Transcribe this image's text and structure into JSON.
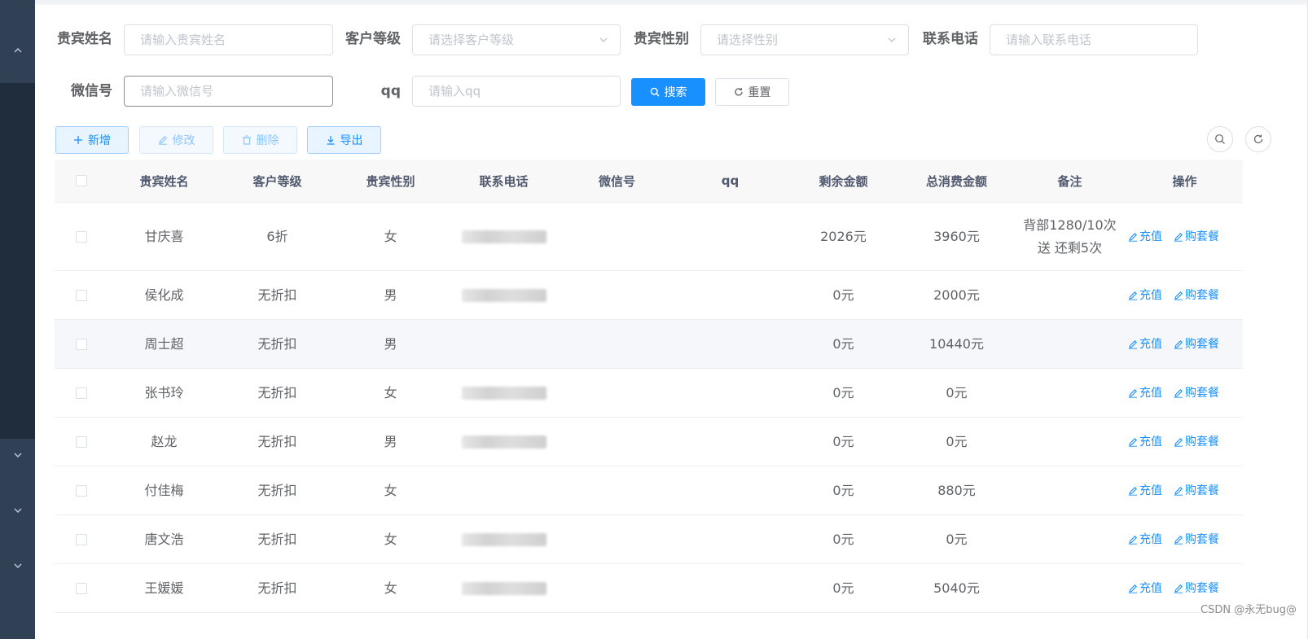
{
  "search_form": {
    "guest_name": {
      "label": "贵宾姓名",
      "placeholder": "请输入贵宾姓名"
    },
    "customer_level": {
      "label": "客户等级",
      "placeholder": "请选择客户等级"
    },
    "guest_gender": {
      "label": "贵宾性别",
      "placeholder": "请选择性别"
    },
    "contact_phone": {
      "label": "联系电话",
      "placeholder": "请输入联系电话"
    },
    "wechat": {
      "label": "微信号",
      "placeholder": "请输入微信号"
    },
    "qq": {
      "label": "qq",
      "placeholder": "请输入qq"
    },
    "search_button": "搜索",
    "reset_button": "重置"
  },
  "toolbar": {
    "add": "新增",
    "edit": "修改",
    "delete": "删除",
    "export": "导出"
  },
  "table": {
    "columns": [
      "贵宾姓名",
      "客户等级",
      "贵宾性别",
      "联系电话",
      "微信号",
      "qq",
      "剩余金额",
      "总消费金额",
      "备注",
      "操作"
    ],
    "rows": [
      {
        "name": "甘庆喜",
        "level": "6折",
        "gender": "女",
        "phone_redacted": true,
        "wechat": "",
        "qq": "",
        "balance": "2026元",
        "total": "3960元",
        "note_line1": "背部1280/10次",
        "note_line2": "送 还剩5次"
      },
      {
        "name": "侯化成",
        "level": "无折扣",
        "gender": "男",
        "phone_redacted": true,
        "wechat": "",
        "qq": "",
        "balance": "0元",
        "total": "2000元",
        "note_line1": "",
        "note_line2": ""
      },
      {
        "name": "周士超",
        "level": "无折扣",
        "gender": "男",
        "phone_redacted": false,
        "wechat": "",
        "qq": "",
        "balance": "0元",
        "total": "10440元",
        "note_line1": "",
        "note_line2": ""
      },
      {
        "name": "张书玲",
        "level": "无折扣",
        "gender": "女",
        "phone_redacted": true,
        "wechat": "",
        "qq": "",
        "balance": "0元",
        "total": "0元",
        "note_line1": "",
        "note_line2": ""
      },
      {
        "name": "赵龙",
        "level": "无折扣",
        "gender": "男",
        "phone_redacted": true,
        "wechat": "",
        "qq": "",
        "balance": "0元",
        "total": "0元",
        "note_line1": "",
        "note_line2": ""
      },
      {
        "name": "付佳梅",
        "level": "无折扣",
        "gender": "女",
        "phone_redacted": false,
        "wechat": "",
        "qq": "",
        "balance": "0元",
        "total": "880元",
        "note_line1": "",
        "note_line2": ""
      },
      {
        "name": "唐文浩",
        "level": "无折扣",
        "gender": "女",
        "phone_redacted": true,
        "wechat": "",
        "qq": "",
        "balance": "0元",
        "total": "0元",
        "note_line1": "",
        "note_line2": ""
      },
      {
        "name": "王媛媛",
        "level": "无折扣",
        "gender": "女",
        "phone_redacted": true,
        "wechat": "",
        "qq": "",
        "balance": "0元",
        "total": "5040元",
        "note_line1": "",
        "note_line2": ""
      }
    ],
    "actions": {
      "recharge": "充值",
      "buy_package": "购套餐"
    }
  },
  "watermark": "CSDN @永无bug@",
  "colors": {
    "primary": "#1890ff",
    "sidebar": "#304156",
    "sidebar_dark": "#1f2d3d"
  },
  "icons": [
    "search-icon",
    "refresh-icon",
    "plus-icon",
    "edit-icon",
    "delete-icon",
    "download-icon",
    "chevron-down-icon",
    "chevron-up-icon"
  ]
}
